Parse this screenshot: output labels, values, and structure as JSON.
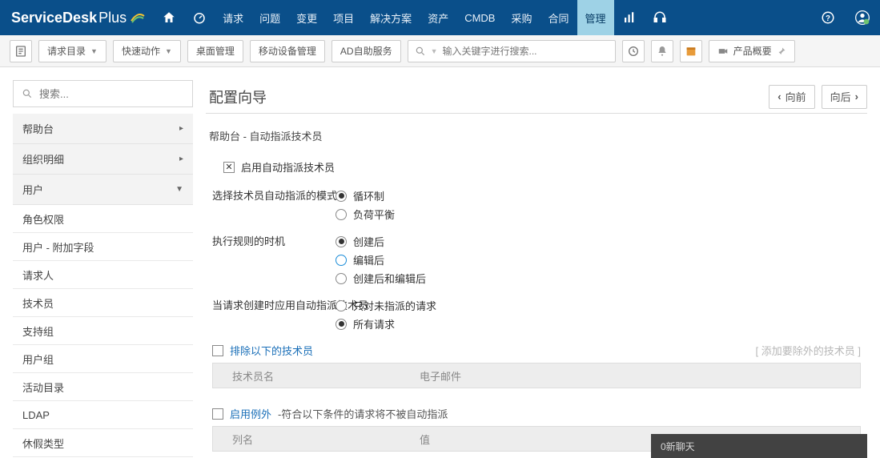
{
  "brand": {
    "bold": "ServiceDesk",
    "light": " Plus"
  },
  "nav": [
    "请求",
    "问题",
    "变更",
    "项目",
    "解决方案",
    "资产",
    "CMDB",
    "采购",
    "合同",
    "管理"
  ],
  "nav_active_index": 9,
  "toolbar": {
    "req_catalog": "请求目录",
    "quick_actions": "快速动作",
    "desktop_mgmt": "桌面管理",
    "mobile_mgmt": "移动设备管理",
    "ad_self": "AD自助服务",
    "search_placeholder": "输入关键字进行搜索...",
    "product_overview": "产品概要"
  },
  "sidebar": {
    "search_placeholder": "搜索...",
    "groups": [
      {
        "label": "帮助台",
        "expanded": false
      },
      {
        "label": "组织明细",
        "expanded": false
      },
      {
        "label": "用户",
        "expanded": true
      }
    ],
    "user_items": [
      "角色权限",
      "用户 - 附加字段",
      "请求人",
      "技术员",
      "支持组",
      "用户组",
      "活动目录",
      "LDAP",
      "休假类型"
    ]
  },
  "main": {
    "title": "配置向导",
    "btn_prev": "向前",
    "btn_next": "向后",
    "crumb": "帮助台 - 自动指派技术员",
    "enable_label": "启用自动指派技术员",
    "mode_label": "选择技术员自动指派的模式",
    "mode_options": [
      "循环制",
      "负荷平衡"
    ],
    "mode_selected": 0,
    "timing_label": "执行规则的时机",
    "timing_options": [
      "创建后",
      "编辑后",
      "创建后和编辑后"
    ],
    "timing_selected": 0,
    "timing_focus": 1,
    "apply_label": "当请求创建时应用自动指派技术员",
    "apply_options": [
      "只对未指派的请求",
      "所有请求"
    ],
    "apply_selected": 1,
    "exclude_link": "排除以下的技术员",
    "exclude_hint": "[ 添加要除外的技术员 ]",
    "exclude_cols": [
      "技术员名",
      "电子邮件"
    ],
    "exception_link": "启用例外",
    "exception_tail": "-符合以下条件的请求将不被自动指派",
    "exception_cols": [
      "列名",
      "值"
    ]
  },
  "chat": {
    "label": "0新聊天"
  }
}
